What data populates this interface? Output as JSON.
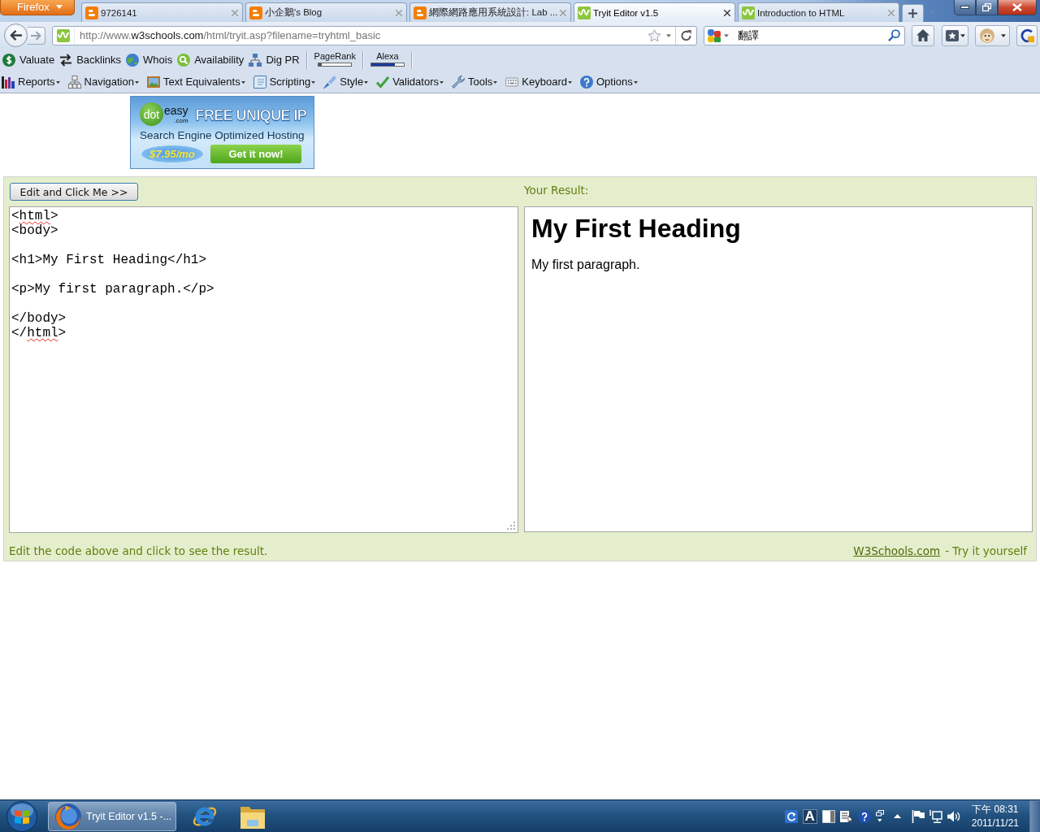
{
  "browser": {
    "app_menu": "Firefox",
    "tabs": [
      {
        "title": "9726141",
        "kind": "blog",
        "selected": false
      },
      {
        "title": "小企鵝's Blog",
        "kind": "blog",
        "selected": false
      },
      {
        "title": "網際網路應用系統設計: Lab ...",
        "kind": "blog",
        "selected": false
      },
      {
        "title": "Tryit Editor v1.5",
        "kind": "w3",
        "selected": true
      },
      {
        "title": "Introduction to HTML",
        "kind": "w3",
        "selected": false
      }
    ],
    "address": [
      {
        "text": "http://www.",
        "kind": "plain"
      },
      {
        "text": "w3schools.com",
        "kind": "domain"
      },
      {
        "text": "/html/tryit.asp?filename=tryhtml_basic",
        "kind": "plain"
      }
    ],
    "search": {
      "value": "翻譯"
    }
  },
  "seo_toolbar": {
    "items": [
      {
        "label": "Valuate",
        "kind": "dollar"
      },
      {
        "label": "Backlinks",
        "kind": "arrows"
      },
      {
        "label": "Whois",
        "kind": "globe"
      },
      {
        "label": "Availability",
        "kind": "magnifier"
      },
      {
        "label": "Dig PR",
        "kind": "network"
      }
    ],
    "meters": [
      {
        "label": "PageRank",
        "level": 0.1
      },
      {
        "label": "Alexa",
        "level": 0.72
      }
    ]
  },
  "menu_toolbar": {
    "menus": [
      {
        "label": "Reports",
        "kind": "chart"
      },
      {
        "label": "Navigation",
        "kind": "sitemap"
      },
      {
        "label": "Text Equivalents",
        "kind": "picture"
      },
      {
        "label": "Scripting",
        "kind": "page"
      },
      {
        "label": "Style",
        "kind": "brush"
      },
      {
        "label": "Validators",
        "kind": "check"
      },
      {
        "label": "Tools",
        "kind": "wrench"
      },
      {
        "label": "Keyboard",
        "kind": "keyboard"
      },
      {
        "label": "Options",
        "kind": "help"
      }
    ]
  },
  "ad": {
    "logo_parts": [
      "dot",
      "easy"
    ],
    "logo_domain": ".com",
    "headline": "FREE UNIQUE IP",
    "tagline": "Search Engine Optimized Hosting",
    "price": "$7.95/mo",
    "cta": "Get it now!"
  },
  "tryit": {
    "run_button": "Edit and Click Me >>",
    "result_label": "Your Result:",
    "code": [
      {
        "text": "<",
        "misspelled": false
      },
      {
        "text": "html",
        "misspelled": true
      },
      {
        "text": ">\n<body>\n\n<h1>My First Heading</h1>\n\n<p>My first paragraph.</p>\n\n</body>\n</",
        "misspelled": false
      },
      {
        "text": "html",
        "misspelled": true
      },
      {
        "text": ">",
        "misspelled": false
      }
    ],
    "result": {
      "heading": "My First Heading",
      "paragraph": "My first paragraph."
    },
    "footer": {
      "note": "Edit the code above and click to see the result.",
      "link": "W3Schools.com",
      "tagline": "- Try it yourself"
    }
  },
  "taskbar": {
    "tasks": [
      {
        "kind": "firefox",
        "label": "Tryit Editor v1.5 -...",
        "selected": true
      },
      {
        "kind": "ie",
        "selected": false
      },
      {
        "kind": "folder",
        "selected": false
      }
    ],
    "ime_mode": "A",
    "time": "下午 08:31",
    "date": "2011/11/21"
  }
}
